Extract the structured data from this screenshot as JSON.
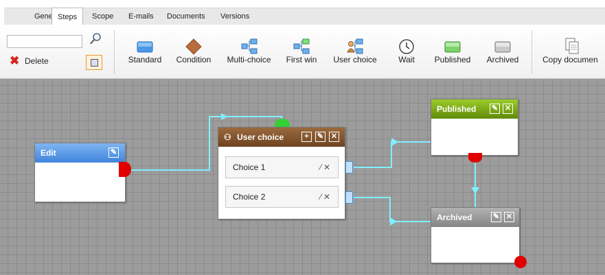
{
  "tabs": [
    "General",
    "Steps",
    "Scope",
    "E-mails",
    "Documents",
    "Versions"
  ],
  "active_tab": "Steps",
  "toolbar": {
    "search_placeholder": "",
    "delete_label": "Delete",
    "tools": [
      {
        "label": "Standard",
        "icon": "standard-step-icon"
      },
      {
        "label": "Condition",
        "icon": "condition-icon"
      },
      {
        "label": "Multi-choice",
        "icon": "multi-choice-icon"
      },
      {
        "label": "First win",
        "icon": "first-win-icon"
      },
      {
        "label": "User choice",
        "icon": "user-choice-icon"
      },
      {
        "label": "Wait",
        "icon": "clock-icon"
      },
      {
        "label": "Published",
        "icon": "published-step-icon"
      },
      {
        "label": "Archived",
        "icon": "archived-step-icon"
      },
      {
        "label": "Copy documen",
        "icon": "copy-document-icon"
      }
    ]
  },
  "steps": {
    "edit": {
      "title": "Edit",
      "color": "#4d8fe0"
    },
    "user_choice": {
      "title": "User choice",
      "color": "#7a4f2a",
      "choices": [
        "Choice 1",
        "Choice 2"
      ]
    },
    "published": {
      "title": "Published",
      "color": "#6f9a10"
    },
    "archived": {
      "title": "Archived",
      "color": "#8a8a8a"
    }
  },
  "colors": {
    "wire": "#7ff0ff",
    "output_dot": "#e10000",
    "input_dot": "#33d133"
  }
}
